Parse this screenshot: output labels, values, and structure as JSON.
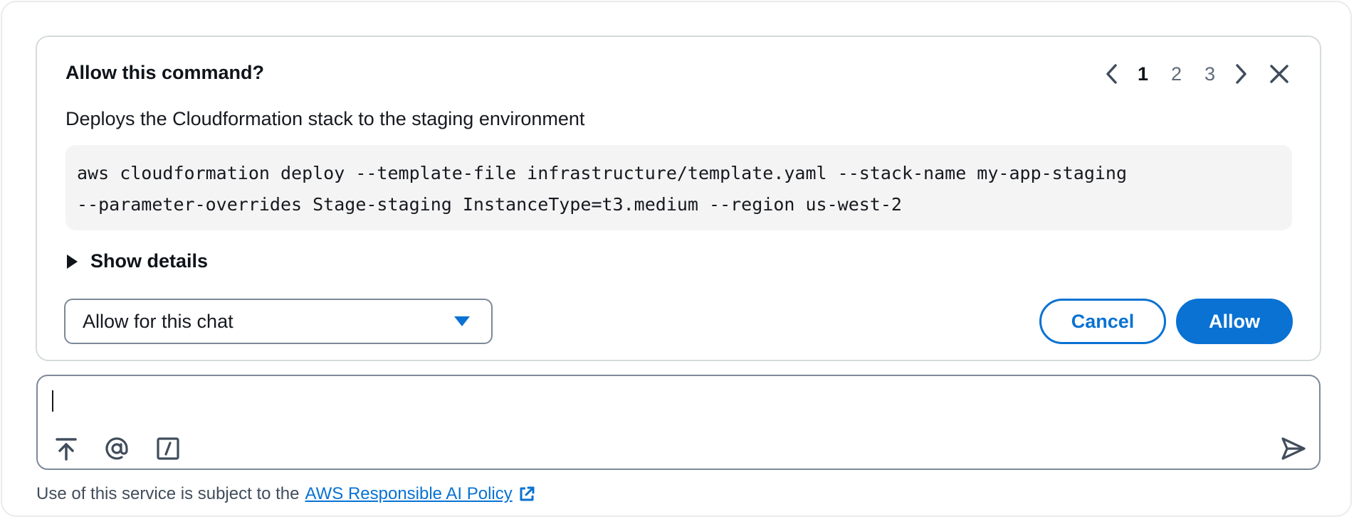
{
  "prompt": {
    "title": "Allow this command?",
    "description": "Deploys the Cloudformation stack to the staging environment",
    "command_lines": [
      "aws cloudformation deploy --template-file infrastructure/template.yaml --stack-name my-app-staging",
      "--parameter-overrides Stage-staging InstanceType=t3.medium --region us-west-2"
    ],
    "show_details_label": "Show details",
    "permission_select": {
      "value": "Allow for this chat"
    },
    "cancel_label": "Cancel",
    "allow_label": "Allow",
    "pagination": {
      "pages": [
        "1",
        "2",
        "3"
      ],
      "current": "1"
    }
  },
  "chat": {
    "input_value": "",
    "tools": [
      "upload-icon",
      "at-mention-icon",
      "slash-command-icon"
    ],
    "send_icon": "send-icon"
  },
  "footer": {
    "text": "Use of this service is subject to the",
    "link_text": "AWS Responsible AI Policy",
    "link_icon": "external-link-icon"
  },
  "colors": {
    "accent": "#0972d3",
    "text": "#16191f",
    "code_bg": "#f4f4f4",
    "border": "#7d8998"
  }
}
